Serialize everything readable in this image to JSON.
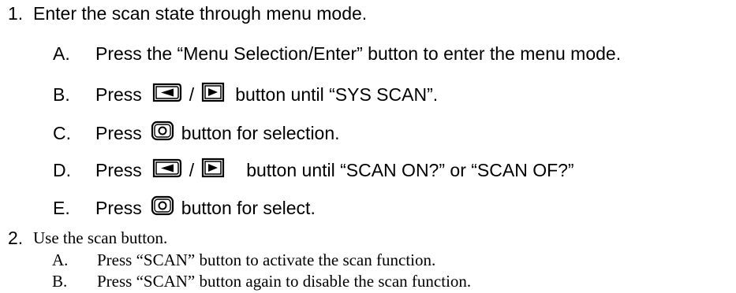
{
  "steps": [
    {
      "number": "1.",
      "title": "Enter the scan state through menu mode.",
      "substeps": [
        {
          "letter": "A.",
          "text": "Press the “Menu Selection/Enter” button to enter the menu mode."
        },
        {
          "letter": "B.",
          "pre": "Press",
          "sep": "/",
          "post": "button until “SYS SCAN”.",
          "icons": [
            "left-arrow-button-icon",
            "right-arrow-button-icon"
          ]
        },
        {
          "letter": "C.",
          "pre": "Press",
          "post": "button for selection.",
          "icons": [
            "select-button-icon"
          ]
        },
        {
          "letter": "D.",
          "pre": "Press",
          "sep": "/",
          "post": "button until “SCAN ON?” or “SCAN OF?”",
          "icons": [
            "left-arrow-button-icon",
            "right-arrow-button-icon"
          ]
        },
        {
          "letter": "E.",
          "pre": "Press",
          "post": "button for select.",
          "icons": [
            "select-button-icon"
          ]
        }
      ]
    },
    {
      "number": "2.",
      "title": "Use the scan button.",
      "substeps": [
        {
          "letter": "A.",
          "text": "Press “SCAN” button to activate the scan function."
        },
        {
          "letter": "B.",
          "text": "Press “SCAN” button again to disable the scan function."
        }
      ]
    }
  ]
}
